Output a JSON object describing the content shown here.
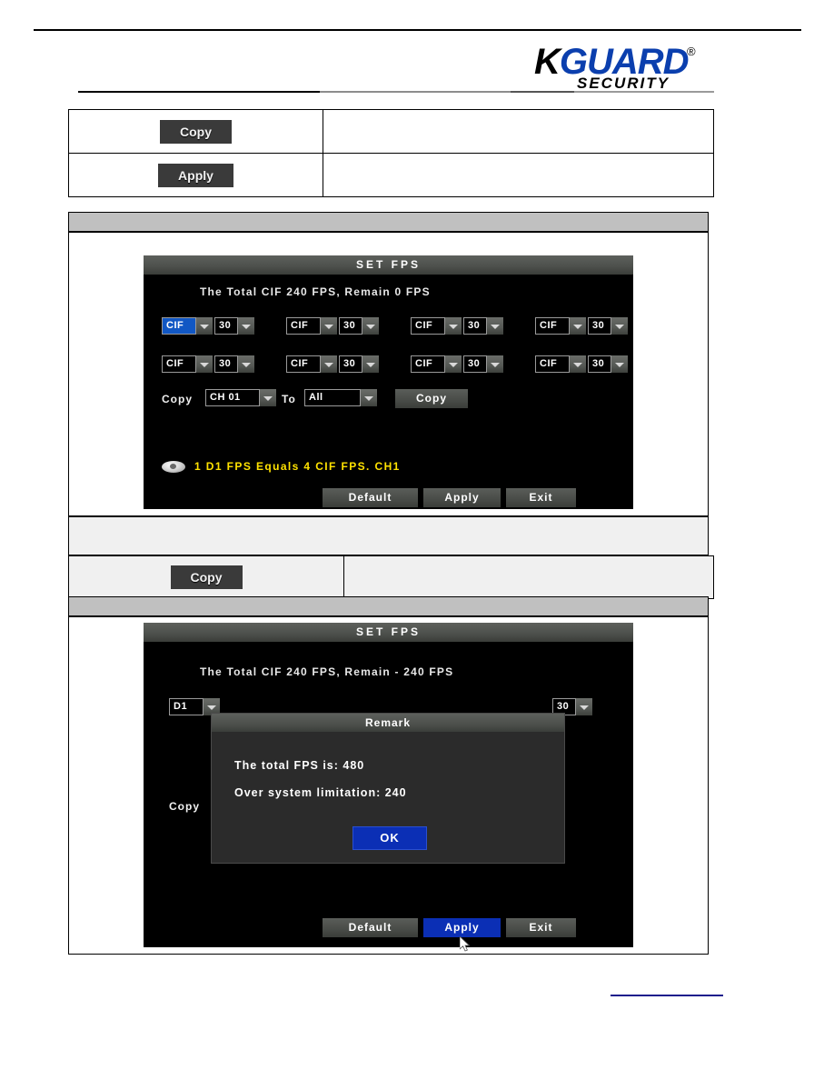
{
  "brand": {
    "logo_k": "K",
    "logo_guard": "GUARD",
    "logo_registered": "®",
    "logo_sub": "SECURITY"
  },
  "doc_table_top": {
    "rows": [
      {
        "button_label": "Copy",
        "description": ""
      },
      {
        "button_label": "Apply",
        "description": ""
      }
    ]
  },
  "doc_table_mid": {
    "rows": [
      {
        "button_label": "Copy",
        "description": ""
      }
    ]
  },
  "panel1": {
    "title": "SET  FPS",
    "total_line": "The  Total  CIF      240  FPS,   Remain         0   FPS",
    "channels": [
      {
        "resolution": "CIF",
        "fps": "30",
        "selected": true
      },
      {
        "resolution": "CIF",
        "fps": "30",
        "selected": false
      },
      {
        "resolution": "CIF",
        "fps": "30",
        "selected": false
      },
      {
        "resolution": "CIF",
        "fps": "30",
        "selected": false
      },
      {
        "resolution": "CIF",
        "fps": "30",
        "selected": false
      },
      {
        "resolution": "CIF",
        "fps": "30",
        "selected": false
      },
      {
        "resolution": "CIF",
        "fps": "30",
        "selected": false
      },
      {
        "resolution": "CIF",
        "fps": "30",
        "selected": false
      }
    ],
    "copy_label": "Copy",
    "copy_source": "CH  01",
    "to_label": "To",
    "copy_target": "All",
    "copy_button": "Copy",
    "note": "1  D1  FPS  Equals  4  CIF  FPS.  CH1",
    "buttons": {
      "default": "Default",
      "apply": "Apply",
      "exit": "Exit"
    }
  },
  "panel2": {
    "title": "SET  FPS",
    "total_line": "The  Total  CIF      240  FPS,   Remain    - 240   FPS",
    "first_channel_resolution": "D1",
    "last_channel_fps": "30",
    "copy_label": "Copy",
    "buttons": {
      "default": "Default",
      "apply": "Apply",
      "exit": "Exit"
    }
  },
  "modal": {
    "title": "Remark",
    "line1": "The  total  FPS  is: 480",
    "line2": "Over  system  limitation: 240",
    "ok_label": "OK"
  },
  "colors": {
    "brand_blue": "#0b3fae",
    "dvr_background": "#000000",
    "selection_blue": "#1157c4",
    "note_yellow": "#ffe200",
    "band_gray": "#c0c0c0"
  }
}
